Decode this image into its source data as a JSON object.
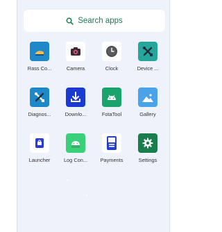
{
  "search": {
    "label": "Search apps"
  },
  "colors": {
    "search_accent": "#1a7d4e",
    "background": "#eef3fb"
  },
  "apps": [
    {
      "label": "Rass Co...",
      "icon": "rass-controller-icon",
      "color": "#1e88c9"
    },
    {
      "label": "Camera",
      "icon": "camera-icon",
      "color": "#ffffff"
    },
    {
      "label": "Clock",
      "icon": "clock-icon",
      "color": "#ffffff"
    },
    {
      "label": "Device ...",
      "icon": "tools-icon",
      "color": "#26a69a"
    },
    {
      "label": "Diagnos...",
      "icon": "tools-icon",
      "color": "#1e88c9"
    },
    {
      "label": "Downlo...",
      "icon": "download-icon",
      "color": "#1a3bd1"
    },
    {
      "label": "FotaTool",
      "icon": "android-icon",
      "color": "#1aa36b"
    },
    {
      "label": "Gallery",
      "icon": "gallery-icon",
      "color": "#4aa3e8"
    },
    {
      "label": "Launcher",
      "icon": "launcher-icon",
      "color": "#2a3bd6"
    },
    {
      "label": "Log Con...",
      "icon": "android-icon",
      "color": "#3ad07a"
    },
    {
      "label": "Payments",
      "icon": "payments-icon",
      "color": "#2740c9"
    },
    {
      "label": "Settings",
      "icon": "gear-icon",
      "color": "#1a7d4e"
    }
  ]
}
